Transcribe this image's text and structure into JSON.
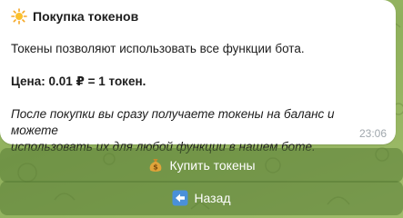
{
  "message": {
    "title": "Покупка токенов",
    "title_icon": "sun-icon",
    "line1": "Токены позволяют использовать все функции бота.",
    "price": "Цена: 0.01 ₽ = 1 токен.",
    "note_line1": "После покупки вы сразу получаете токены на баланс и можете",
    "note_line2": "использовать их для любой функции в нашем боте.",
    "time": "23:06"
  },
  "keyboard": {
    "buy": {
      "label": "Купить токены",
      "icon": "money-bag-icon"
    },
    "back": {
      "label": "Назад",
      "icon": "back-arrow-icon"
    }
  },
  "colors": {
    "bubble": "#ffffff",
    "button": "#6e8f46",
    "background": "#9ab866",
    "back_icon": "#4a90d9"
  }
}
